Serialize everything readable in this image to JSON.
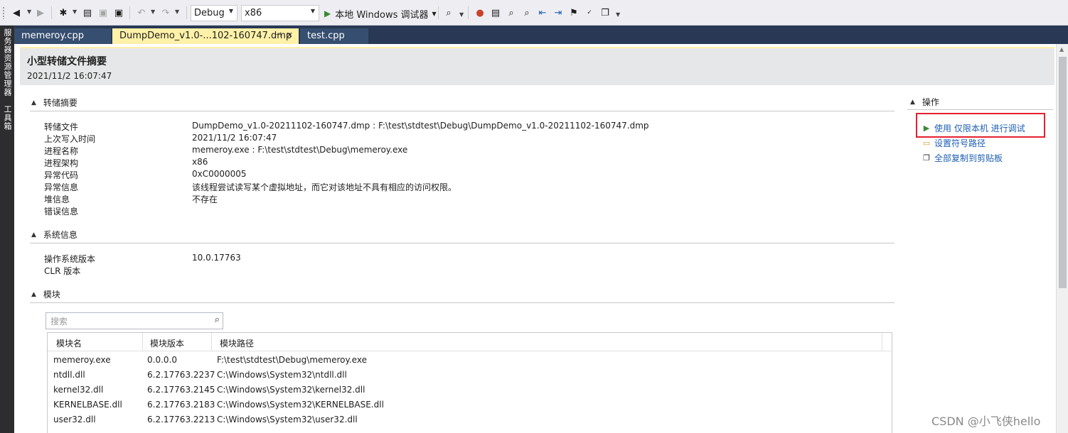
{
  "toolbar": {
    "config": "Debug",
    "platform": "x86",
    "run_label": "本地 Windows 调试器"
  },
  "left_strip": {
    "server_explorer": "服务器资源管理器",
    "toolbox": "工具箱"
  },
  "tabs": [
    {
      "label": "memeroy.cpp"
    },
    {
      "label": "DumpDemo_v1.0-...102-160747.dmp"
    },
    {
      "label": "test.cpp"
    }
  ],
  "header": {
    "title": "小型转储文件摘要",
    "subtitle": "2021/11/2 16:07:47"
  },
  "dump_summary": {
    "heading": "转储摘要",
    "rows": [
      {
        "label": "转储文件",
        "value": "DumpDemo_v1.0-20211102-160747.dmp : F:\\test\\stdtest\\Debug\\DumpDemo_v1.0-20211102-160747.dmp"
      },
      {
        "label": "上次写入时间",
        "value": "2021/11/2 16:07:47"
      },
      {
        "label": "进程名称",
        "value": "memeroy.exe : F:\\test\\stdtest\\Debug\\memeroy.exe"
      },
      {
        "label": "进程架构",
        "value": "x86"
      },
      {
        "label": "异常代码",
        "value": "0xC0000005"
      },
      {
        "label": "异常信息",
        "value": "该线程尝试读写某个虚拟地址，而它对该地址不具有相应的访问权限。"
      },
      {
        "label": "堆信息",
        "value": "不存在"
      },
      {
        "label": "错误信息",
        "value": ""
      }
    ]
  },
  "system_info": {
    "heading": "系统信息",
    "rows": [
      {
        "label": "操作系统版本",
        "value": "10.0.17763"
      },
      {
        "label": "CLR 版本",
        "value": ""
      }
    ]
  },
  "modules": {
    "heading": "模块",
    "search_placeholder": "搜索",
    "columns": [
      "模块名",
      "模块版本",
      "模块路径"
    ],
    "rows": [
      [
        "memeroy.exe",
        "0.0.0.0",
        "F:\\test\\stdtest\\Debug\\memeroy.exe"
      ],
      [
        "ntdll.dll",
        "6.2.17763.2237",
        "C:\\Windows\\System32\\ntdll.dll"
      ],
      [
        "kernel32.dll",
        "6.2.17763.2145",
        "C:\\Windows\\System32\\kernel32.dll"
      ],
      [
        "KERNELBASE.dll",
        "6.2.17763.2183",
        "C:\\Windows\\System32\\KERNELBASE.dll"
      ],
      [
        "user32.dll",
        "6.2.17763.2213",
        "C:\\Windows\\System32\\user32.dll"
      ]
    ]
  },
  "actions": {
    "heading": "操作",
    "items": [
      {
        "label": "使用 仅限本机 进行调试",
        "icon": "play-icon"
      },
      {
        "label": "设置符号路径",
        "icon": "folder-icon"
      },
      {
        "label": "全部复制到剪贴板",
        "icon": "copy-icon"
      }
    ]
  },
  "watermark": "CSDN @小飞侠hello"
}
